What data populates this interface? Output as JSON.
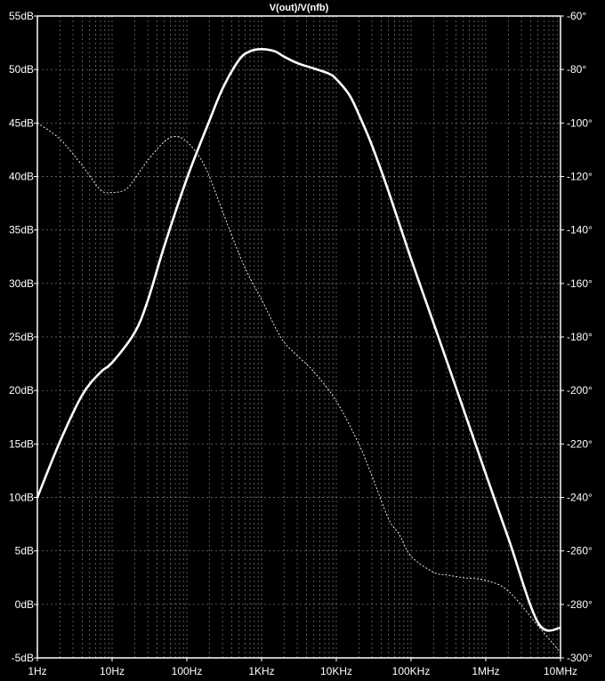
{
  "chart_data": {
    "type": "line",
    "title": "V(out)/V(nfb)",
    "x_scale": "log",
    "xlim_hz": [
      1,
      10000000
    ],
    "x_ticks": [
      {
        "value": 1,
        "label": "1Hz"
      },
      {
        "value": 10,
        "label": "10Hz"
      },
      {
        "value": 100,
        "label": "100Hz"
      },
      {
        "value": 1000,
        "label": "1KHz"
      },
      {
        "value": 10000,
        "label": "10KHz"
      },
      {
        "value": 100000,
        "label": "100KHz"
      },
      {
        "value": 1000000,
        "label": "1MHz"
      },
      {
        "value": 10000000,
        "label": "10MHz"
      }
    ],
    "y_left": {
      "ylim": [
        -5,
        55
      ],
      "ticks": [
        {
          "value": 55,
          "label": "55dB"
        },
        {
          "value": 50,
          "label": "50dB"
        },
        {
          "value": 45,
          "label": "45dB"
        },
        {
          "value": 40,
          "label": "40dB"
        },
        {
          "value": 35,
          "label": "35dB"
        },
        {
          "value": 30,
          "label": "30dB"
        },
        {
          "value": 25,
          "label": "25dB"
        },
        {
          "value": 20,
          "label": "20dB"
        },
        {
          "value": 15,
          "label": "15dB"
        },
        {
          "value": 10,
          "label": "10dB"
        },
        {
          "value": 5,
          "label": "5dB"
        },
        {
          "value": 0,
          "label": "0dB"
        },
        {
          "value": -5,
          "label": "-5dB"
        }
      ]
    },
    "y_right": {
      "ylim": [
        -300,
        -60
      ],
      "ticks": [
        {
          "value": -60,
          "label": "-60°"
        },
        {
          "value": -80,
          "label": "-80°"
        },
        {
          "value": -100,
          "label": "-100°"
        },
        {
          "value": -120,
          "label": "-120°"
        },
        {
          "value": -140,
          "label": "-140°"
        },
        {
          "value": -160,
          "label": "-160°"
        },
        {
          "value": -180,
          "label": "-180°"
        },
        {
          "value": -200,
          "label": "-200°"
        },
        {
          "value": -220,
          "label": "-220°"
        },
        {
          "value": -240,
          "label": "-240°"
        },
        {
          "value": -260,
          "label": "-260°"
        },
        {
          "value": -280,
          "label": "-280°"
        },
        {
          "value": -300,
          "label": "-300°"
        }
      ]
    },
    "grid": true,
    "series": [
      {
        "style": "solid",
        "axis": "left",
        "x": [
          1,
          2,
          4,
          7,
          10,
          20,
          30,
          50,
          100,
          200,
          300,
          500,
          700,
          1000,
          1500,
          2000,
          3000,
          5000,
          8000,
          10000,
          15000,
          20000,
          30000,
          50000,
          100000,
          200000,
          500000,
          1000000,
          2000000,
          5000000,
          10000000
        ],
        "values": [
          10,
          15.2,
          19.6,
          21.7,
          22.6,
          25.4,
          28.4,
          33.5,
          39.8,
          45.2,
          48.2,
          50.9,
          51.7,
          51.9,
          51.7,
          51.2,
          50.6,
          50.1,
          49.6,
          49.1,
          47.6,
          45.8,
          42.9,
          38.6,
          32.3,
          26.3,
          18.3,
          12.2,
          6.2,
          -1.7,
          -2.2
        ]
      },
      {
        "style": "dashed",
        "axis": "right",
        "x": [
          1,
          2,
          4,
          7,
          10,
          15,
          20,
          30,
          50,
          70,
          100,
          150,
          200,
          300,
          500,
          700,
          1000,
          1500,
          2000,
          3000,
          5000,
          10000,
          20000,
          30000,
          50000,
          70000,
          100000,
          200000,
          300000,
          500000,
          1000000,
          2000000,
          5000000,
          10000000
        ],
        "values": [
          -100,
          -106,
          -116,
          -125,
          -126,
          -125,
          -121,
          -114,
          -107,
          -105,
          -107,
          -113,
          -120,
          -133,
          -149,
          -158,
          -166,
          -176,
          -182,
          -187,
          -193,
          -204,
          -220,
          -232,
          -248,
          -254,
          -262,
          -268,
          -269,
          -270,
          -271,
          -275,
          -288,
          -298
        ]
      }
    ]
  }
}
